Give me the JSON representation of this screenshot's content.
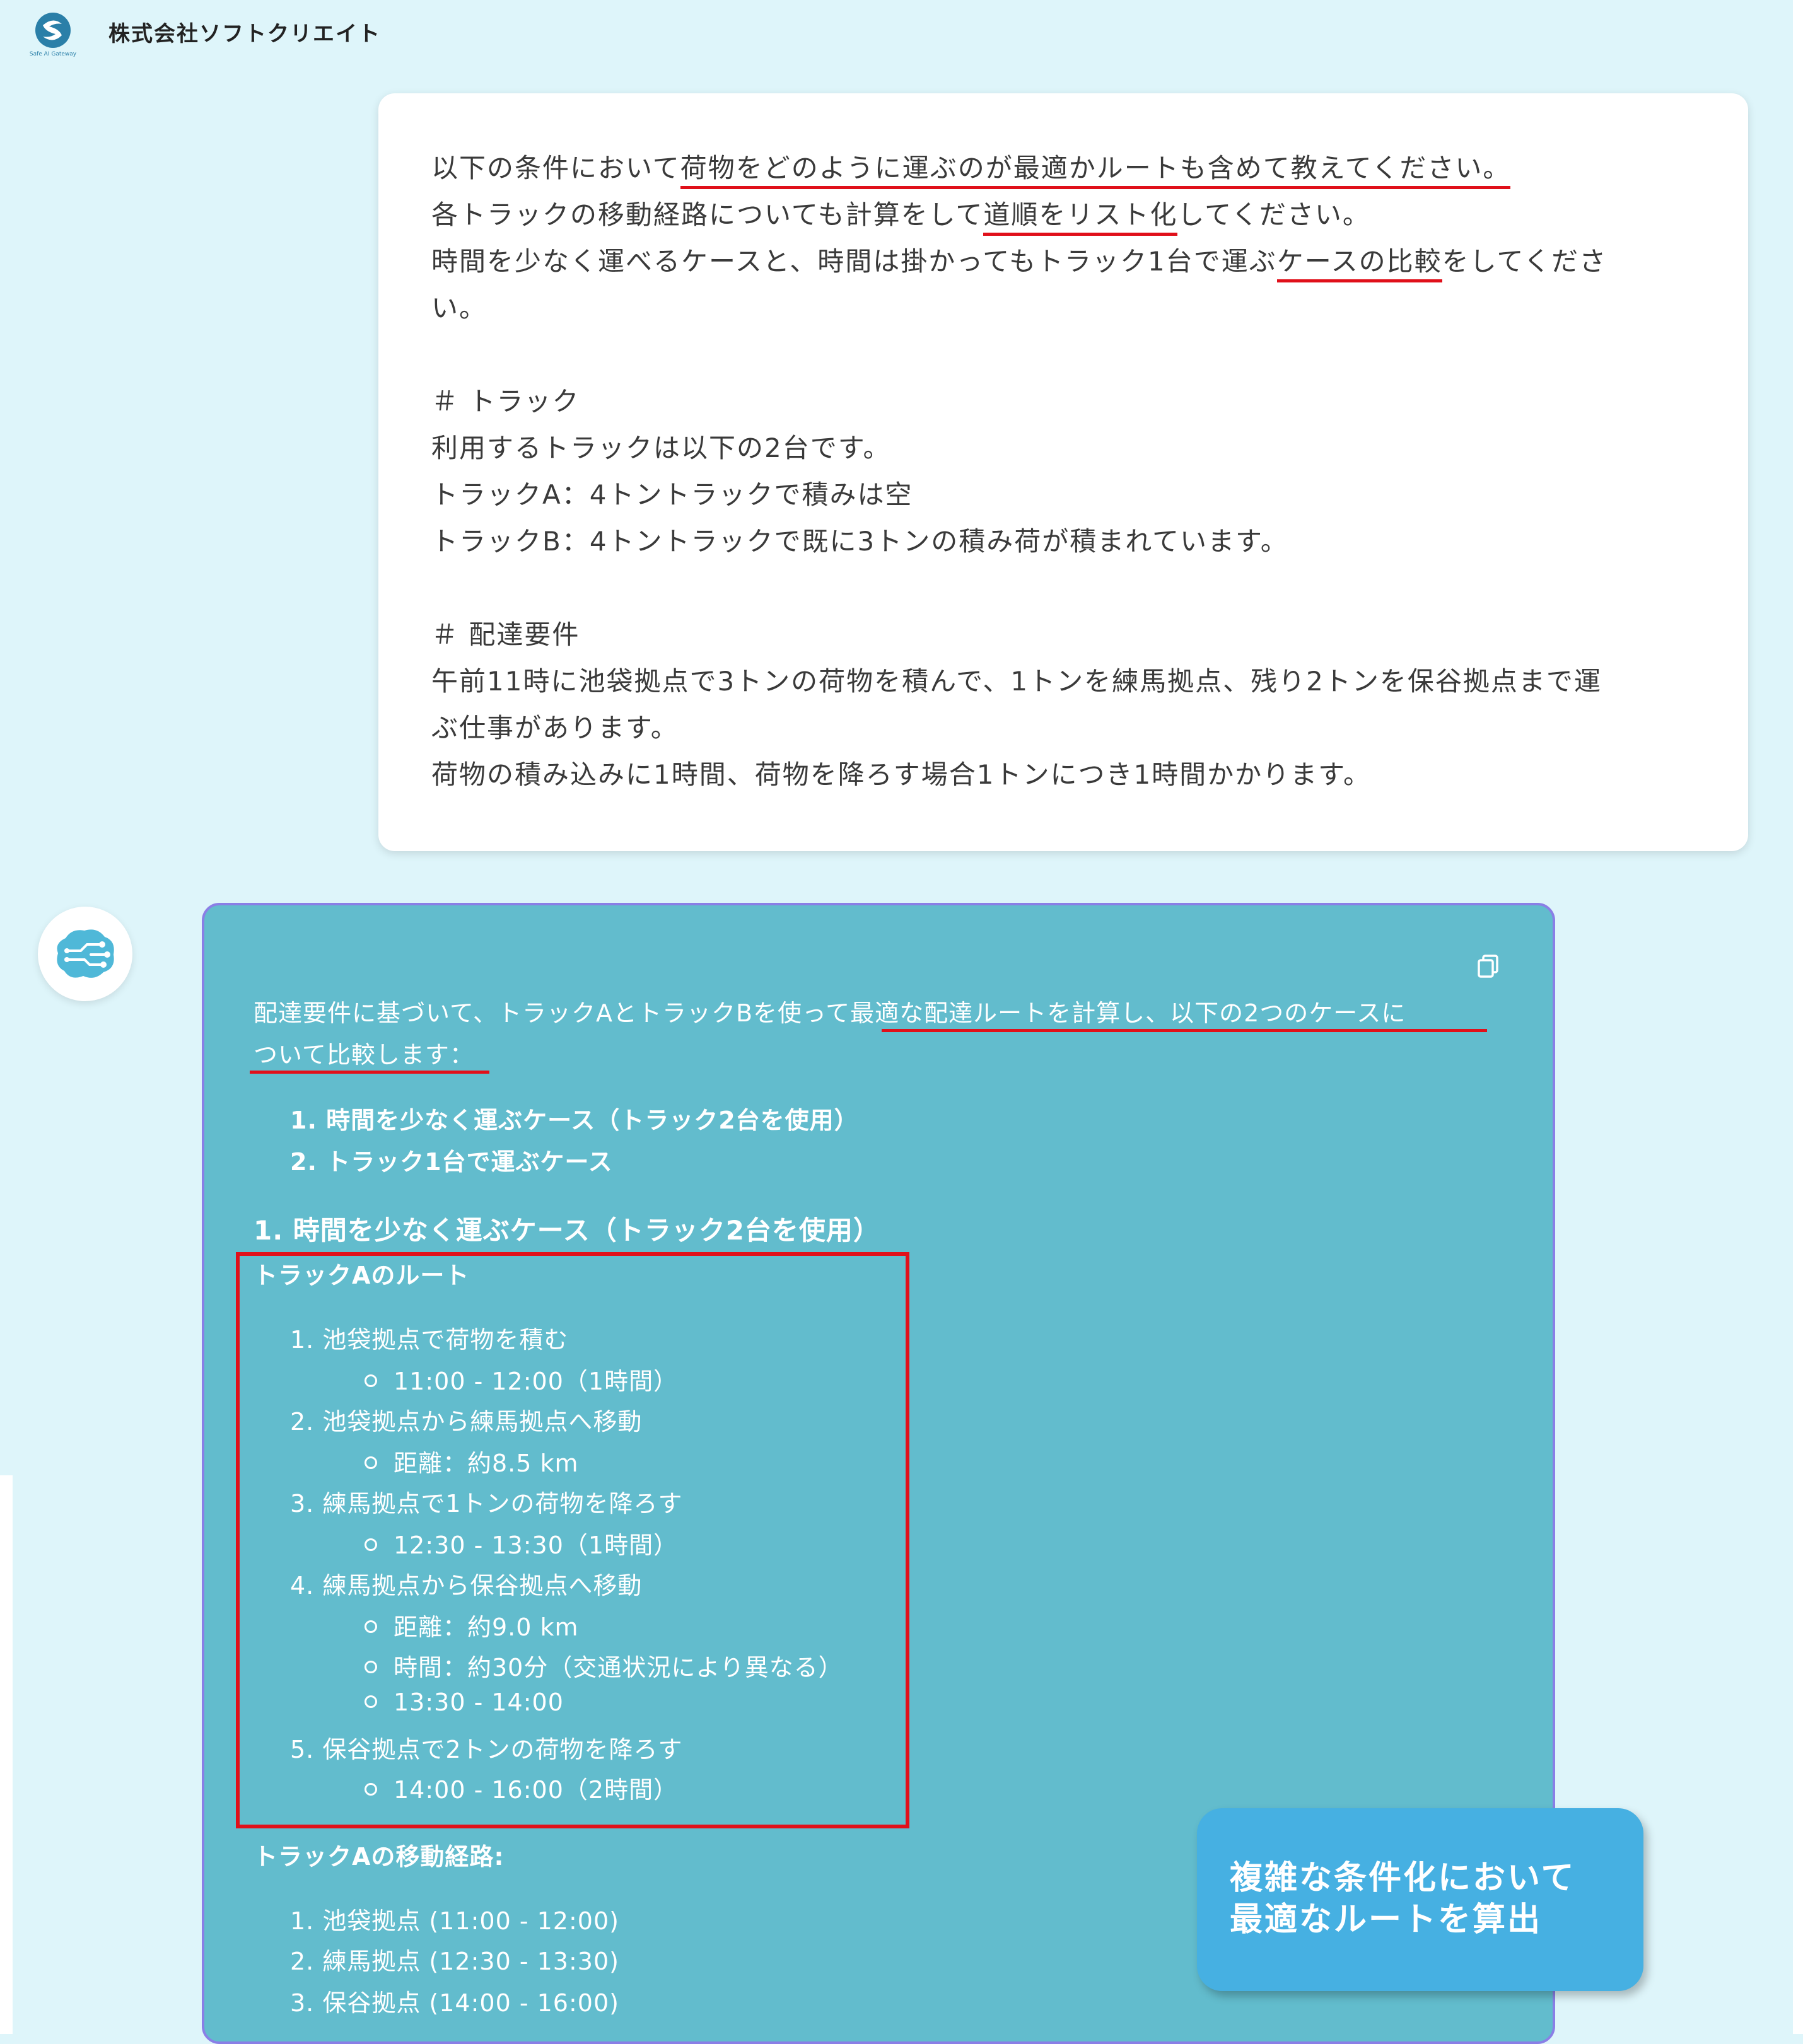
{
  "header": {
    "company_name": "株式会社ソフトクリエイト",
    "logo_caption": "Safe AI Gateway"
  },
  "user_message": {
    "lines": [
      {
        "pre": "以下の条件において",
        "u": "荷物をどのように運ぶのが最適かルートも含めて教えてください。",
        "post": ""
      },
      {
        "pre": "各トラックの移動経路についても計算をして",
        "u": "道順をリスト化",
        "post": "してください。"
      },
      {
        "pre": "時間を少なく運べるケースと、時間は掛かってもトラック1台で運ぶ",
        "u": "ケースの比較",
        "post": "をしてくださ"
      },
      {
        "pre": "い。",
        "u": "",
        "post": ""
      },
      {
        "pre": "",
        "u": "",
        "post": ""
      },
      {
        "pre": "＃ トラック",
        "u": "",
        "post": ""
      },
      {
        "pre": "利用するトラックは以下の2台です。",
        "u": "",
        "post": ""
      },
      {
        "pre": "トラックA：4トントラックで積みは空",
        "u": "",
        "post": ""
      },
      {
        "pre": "トラックB：4トントラックで既に3トンの積み荷が積まれています。",
        "u": "",
        "post": ""
      },
      {
        "pre": "",
        "u": "",
        "post": ""
      },
      {
        "pre": "＃ 配達要件",
        "u": "",
        "post": ""
      },
      {
        "pre": "午前11時に池袋拠点で3トンの荷物を積んで、1トンを練馬拠点、残り2トンを保谷拠点まで運",
        "u": "",
        "post": ""
      },
      {
        "pre": "ぶ仕事があります。",
        "u": "",
        "post": ""
      },
      {
        "pre": "荷物の積み込みに1時間、荷物を降ろす場合1トンにつき1時間かかります。",
        "u": "",
        "post": ""
      }
    ]
  },
  "ai_answer": {
    "intro_line1": "配達要件に基づいて、トラックAとトラックBを使って最適な配達ルートを計算し、以下の2つのケースに",
    "intro_line2": "ついて比較します：",
    "cases": [
      "1. 時間を少なく運ぶケース（トラック2台を使用）",
      "2. トラック1台で運ぶケース"
    ],
    "section_heading": "1. 時間を少なく運ぶケース（トラック2台を使用）",
    "route_heading": "トラックAのルート",
    "route_steps": [
      {
        "label": "1. 池袋拠点で荷物を積む",
        "details": [
          "11:00 - 12:00（1時間）"
        ]
      },
      {
        "label": "2. 池袋拠点から練馬拠点へ移動",
        "details": [
          "距離：約8.5 km"
        ]
      },
      {
        "label": "3. 練馬拠点で1トンの荷物を降ろす",
        "details": [
          "12:30 - 13:30（1時間）"
        ]
      },
      {
        "label": "4. 練馬拠点から保谷拠点へ移動",
        "details": [
          "距離：約9.0 km",
          "時間：約30分（交通状況により異なる）",
          "13:30 - 14:00"
        ]
      },
      {
        "label": "5. 保谷拠点で2トンの荷物を降ろす",
        "details": [
          "14:00 - 16:00（2時間）"
        ]
      }
    ],
    "path_heading": "トラックAの移動経路:",
    "path_items": [
      "1. 池袋拠点 (11:00 - 12:00)",
      "2. 練馬拠点 (12:30 - 13:30)",
      "3. 保谷拠点 (14:00 - 16:00)"
    ]
  },
  "callout": {
    "line1": "複雑な条件化において",
    "line2": "最適なルートを算出"
  },
  "colors": {
    "page_bg": "#def5fa",
    "ai_card_bg": "#62bccd",
    "ai_card_border": "#8a7fe6",
    "annotation_red": "#e0101a",
    "callout_bg": "#46b0e2"
  },
  "icons": {
    "logo": "safe-ai-gateway-logo-icon",
    "avatar": "ai-brain-icon",
    "copy": "copy-icon"
  }
}
